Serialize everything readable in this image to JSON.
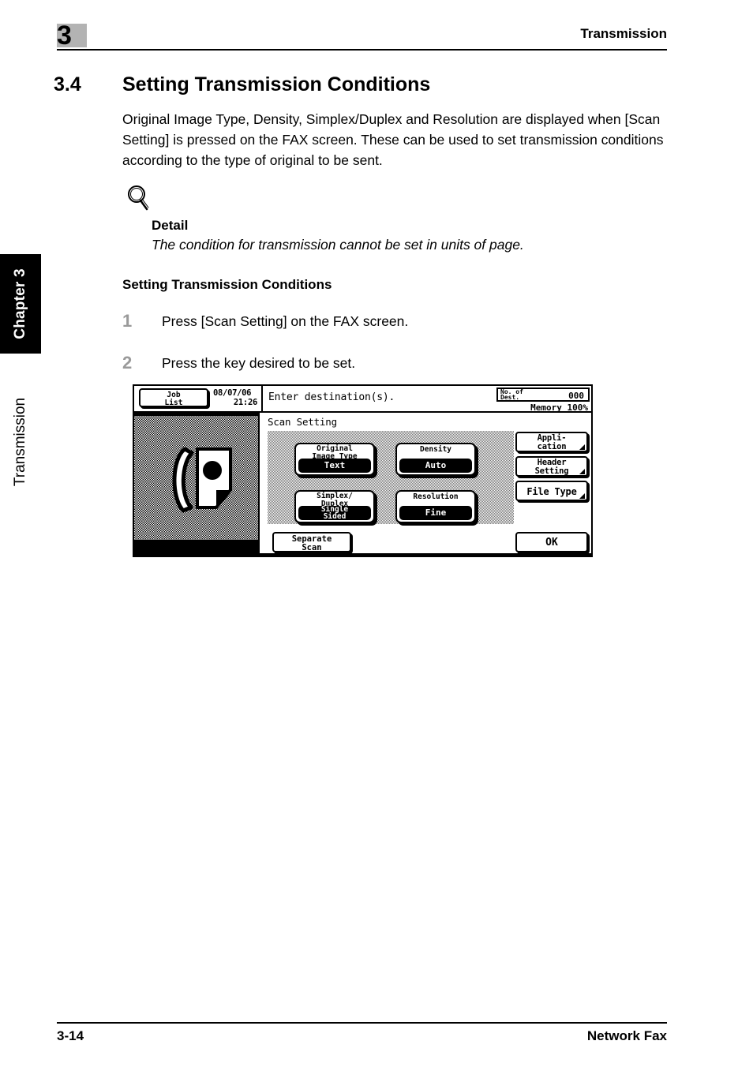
{
  "header": {
    "chapter_number": "3",
    "running_head": "Transmission"
  },
  "footer": {
    "page_number": "3-14",
    "doc_title": "Network Fax"
  },
  "sidebar": {
    "tab_label": "Chapter 3",
    "caption": "Transmission"
  },
  "section": {
    "number": "3.4",
    "title": "Setting Transmission Conditions",
    "intro": "Original Image Type, Density, Simplex/Duplex and Resolution are displayed when [Scan Setting] is pressed on the FAX screen. These can be used to set transmission conditions according to the type of original to be sent."
  },
  "detail": {
    "icon": "magnifier-icon",
    "title": "Detail",
    "text": "The condition for transmission cannot be set in units of page."
  },
  "procedure": {
    "heading": "Setting Transmission Conditions",
    "steps": [
      {
        "num": "1",
        "text": "Press [Scan Setting] on the FAX screen."
      },
      {
        "num": "2",
        "text": "Press the key desired to be set."
      }
    ]
  },
  "lcd": {
    "job_list_line1": "Job",
    "job_list_line2": "List",
    "date": "08/07/06",
    "time": "21:26",
    "prompt": "Enter destination(s).",
    "dest_label_line1": "No. of",
    "dest_label_line2": "Dest.",
    "dest_value": "000",
    "memory": "Memory 100%",
    "fax_icon": "fax-machine-icon",
    "scan_setting_title": "Scan Setting",
    "settings": [
      {
        "key": "original-image-type",
        "label_line1": "Original",
        "label_line2": "Image Type",
        "value_line1": "Text",
        "value_line2": ""
      },
      {
        "key": "density",
        "label_line1": "Density",
        "label_line2": "",
        "value_line1": "Auto",
        "value_line2": ""
      },
      {
        "key": "simplex-duplex",
        "label_line1": "Simplex/",
        "label_line2": "Duplex",
        "value_line1": "Single",
        "value_line2": "Sided"
      },
      {
        "key": "resolution",
        "label_line1": "Resolution",
        "label_line2": "",
        "value_line1": "Fine",
        "value_line2": ""
      }
    ],
    "side_buttons": [
      {
        "key": "application",
        "line1": "Appli-",
        "line2": "cation"
      },
      {
        "key": "header-setting",
        "line1": "Header",
        "line2": "Setting"
      },
      {
        "key": "file-type",
        "line1": "File Type",
        "line2": ""
      }
    ],
    "separate_scan_line1": "Separate",
    "separate_scan_line2": "Scan",
    "ok_label": "OK"
  },
  "colors": {
    "chapter_box": "#b3b3b3",
    "step_number": "#9a9a9a",
    "ink": "#000000",
    "paper": "#ffffff"
  }
}
